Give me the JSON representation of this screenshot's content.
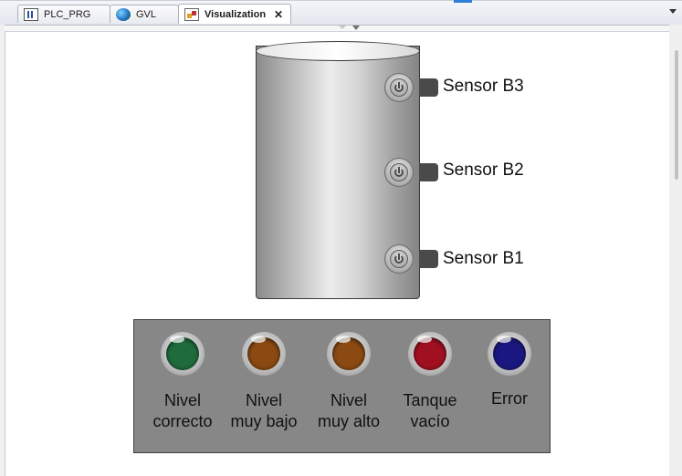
{
  "tabs": [
    {
      "label": "PLC_PRG",
      "icon": "program-icon",
      "active": false
    },
    {
      "label": "GVL",
      "icon": "globe-icon",
      "active": false
    },
    {
      "label": "Visualization",
      "icon": "visualization-icon",
      "active": true
    }
  ],
  "tab_close": "✕",
  "sensors": [
    {
      "label": "Sensor B3"
    },
    {
      "label": "Sensor B2"
    },
    {
      "label": "Sensor B1"
    }
  ],
  "indicators": [
    {
      "line1": "Nivel",
      "line2": "correcto",
      "color": "#1f6b3c"
    },
    {
      "line1": "Nivel",
      "line2": "muy bajo",
      "color": "#8a4a12"
    },
    {
      "line1": "Nivel",
      "line2": "muy alto",
      "color": "#8a4a12"
    },
    {
      "line1": "Tanque",
      "line2": "vacío",
      "color": "#a01020"
    },
    {
      "line1": "Error",
      "line2": "",
      "color": "#1a1880"
    }
  ],
  "colors": {
    "panel_bg": "#878787",
    "tab_accent": "#2f7fd6"
  }
}
